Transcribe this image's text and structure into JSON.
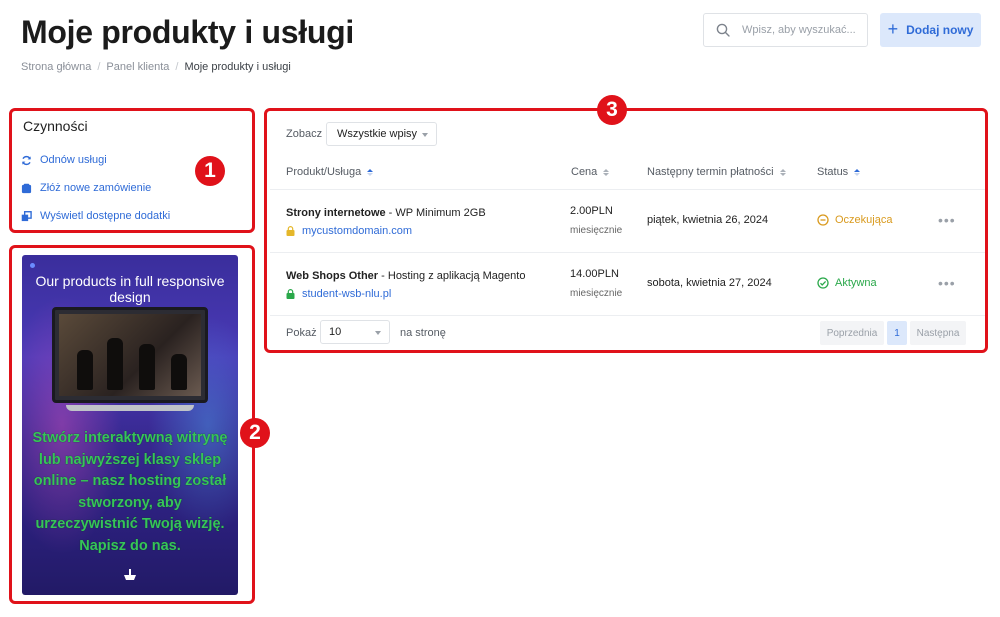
{
  "header": {
    "title": "Moje produkty i usługi",
    "breadcrumb": [
      "Strona główna",
      "Panel klienta",
      "Moje produkty i usługi"
    ],
    "search_placeholder": "Wpisz, aby wyszukać...",
    "add_label": "Dodaj nowy"
  },
  "actions": {
    "title": "Czynności",
    "items": [
      {
        "label": "Odnów usługi",
        "icon": "refresh-icon"
      },
      {
        "label": "Złóż nowe zamówienie",
        "icon": "cart-icon"
      },
      {
        "label": "Wyświetl dostępne dodatki",
        "icon": "addons-icon"
      }
    ]
  },
  "promo": {
    "heading": "Our products in full responsive design",
    "text": "Stwórz interaktywną witrynę lub najwyższej klasy sklep online – nasz hosting został stworzony, aby urzeczywistnić Twoją wizję. Napisz do nas."
  },
  "table": {
    "view_label": "Zobacz",
    "view_value": "Wszystkie wpisy",
    "columns": [
      "Produkt/Usługa",
      "Cena",
      "Następny termin płatności",
      "Status"
    ],
    "rows": [
      {
        "product": "Strony internetowe",
        "plan": " - WP Minimum 2GB",
        "domain": "mycustomdomain.com",
        "price": "2.00PLN",
        "cycle": "miesięcznie",
        "due": "piątek, kwietnia 26, 2024",
        "status": "Oczekująca",
        "status_color": "#d99a1e",
        "more": "•••"
      },
      {
        "product": "Web Shops Other",
        "plan": " - Hosting z aplikacją Magento",
        "domain": "student-wsb-nlu.pl",
        "price": "14.00PLN",
        "cycle": "miesięcznie",
        "due": "sobota, kwietnia 27, 2024",
        "status": "Aktywna",
        "status_color": "#2aa84a",
        "more": "•••"
      }
    ],
    "footer": {
      "show_label": "Pokaż",
      "per_page": "10",
      "per_page_suffix": "na stronę",
      "prev": "Poprzednia",
      "page": "1",
      "next": "Następna"
    }
  },
  "annotations": [
    "1",
    "2",
    "3"
  ],
  "colors": {
    "accent": "#2f6bd7",
    "annotation": "#e0121a"
  }
}
